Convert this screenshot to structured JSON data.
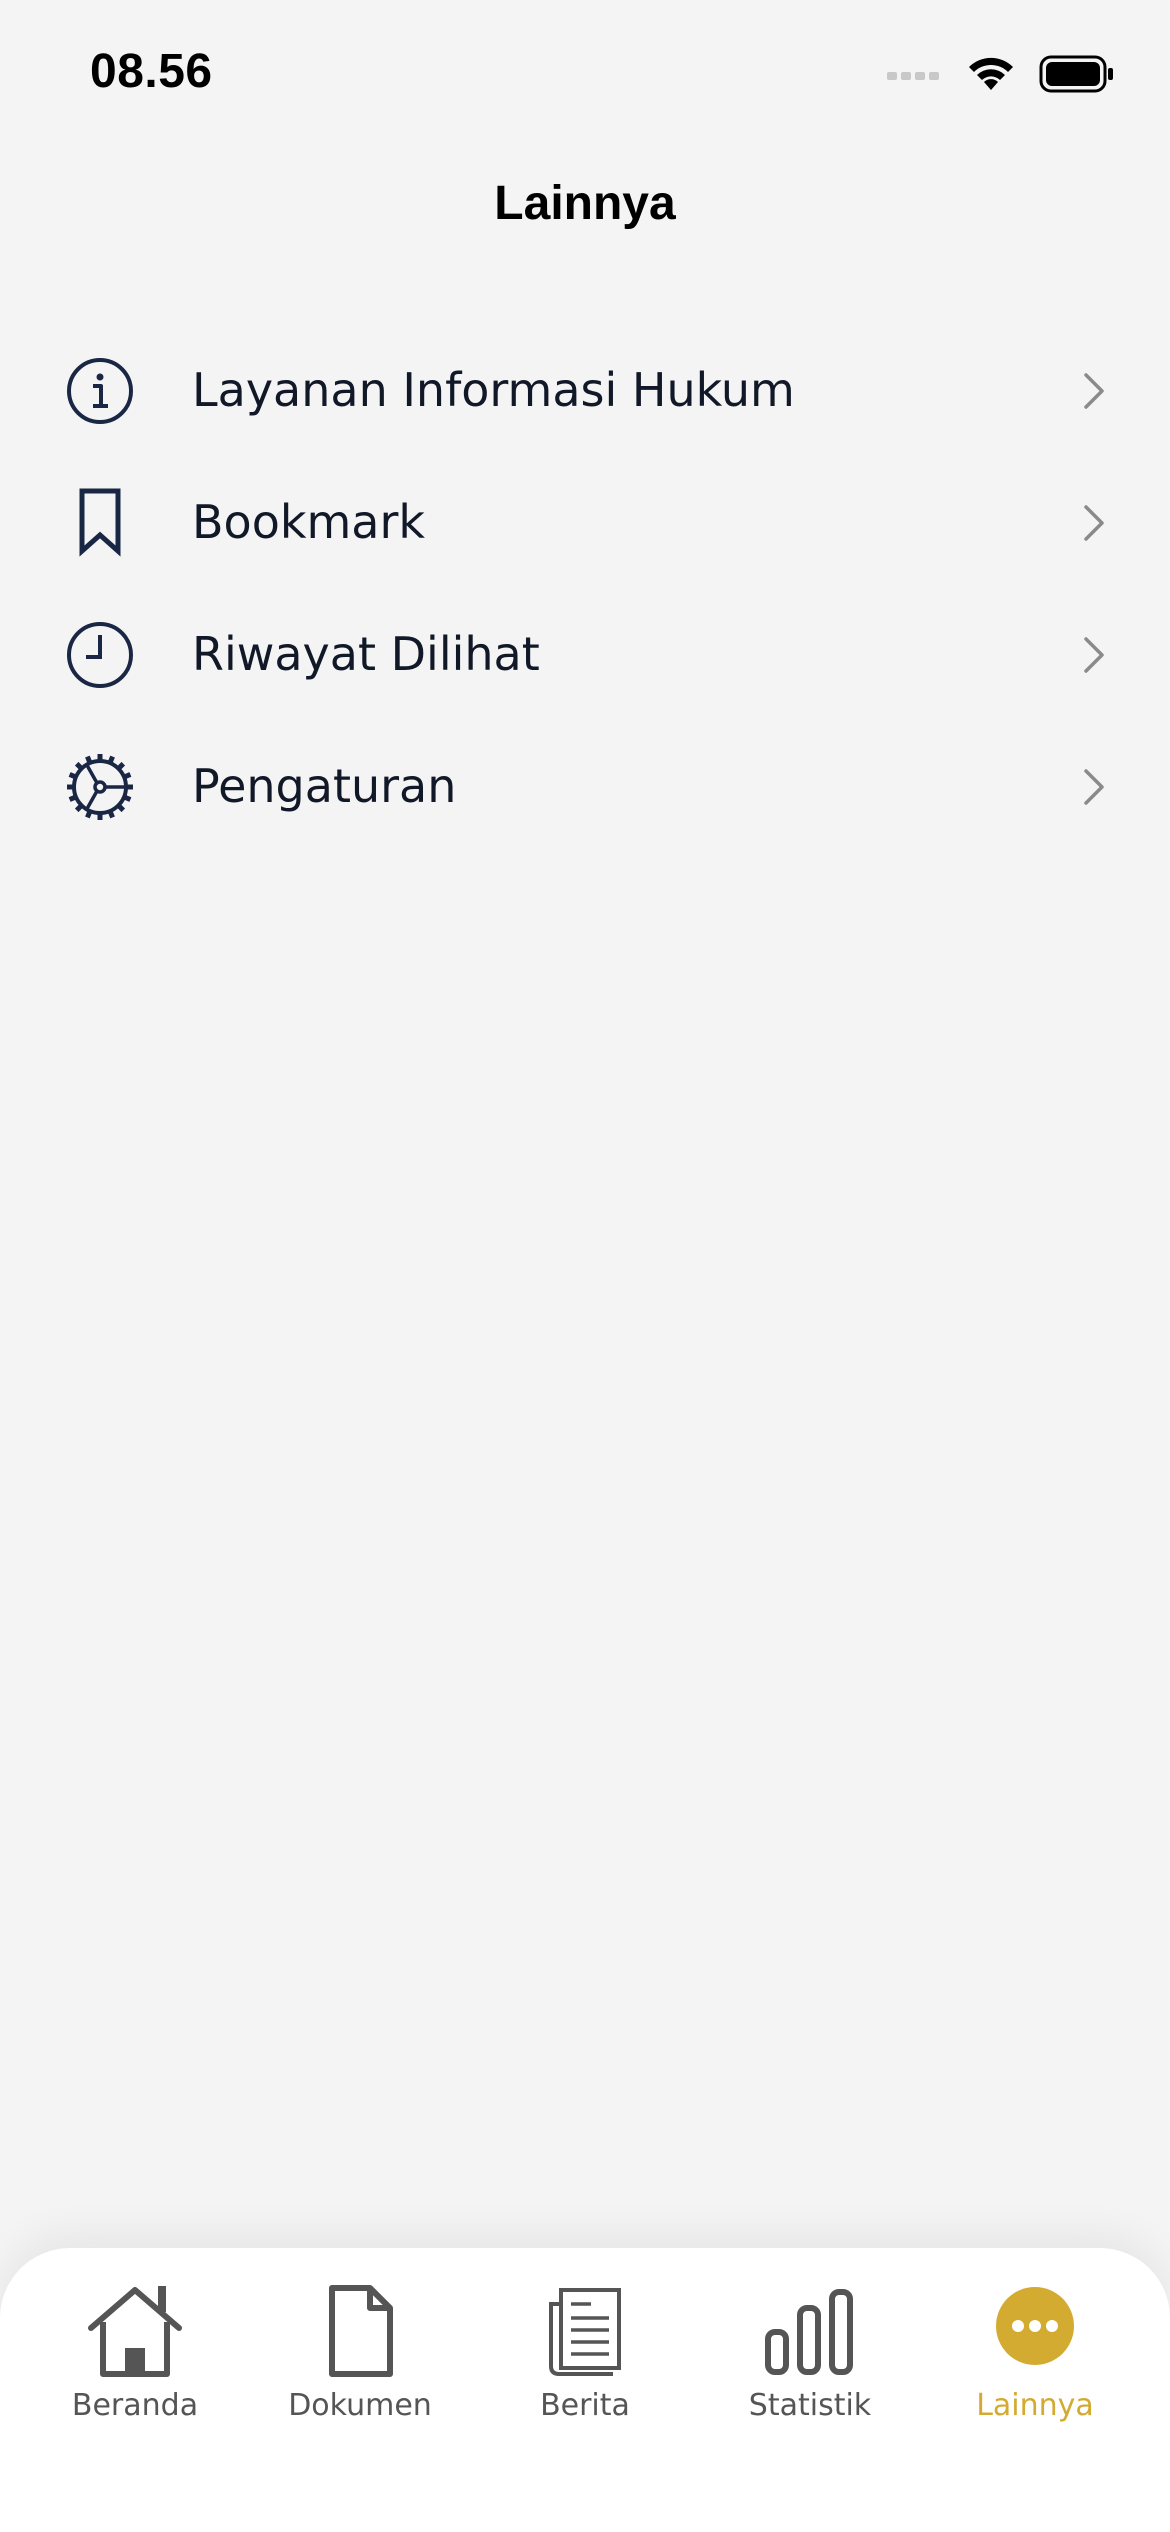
{
  "status_bar": {
    "time": "08.56"
  },
  "header": {
    "title": "Lainnya"
  },
  "menu": {
    "items": [
      {
        "label": "Layanan Informasi Hukum",
        "icon": "info-icon"
      },
      {
        "label": "Bookmark",
        "icon": "bookmark-icon"
      },
      {
        "label": "Riwayat Dilihat",
        "icon": "clock-icon"
      },
      {
        "label": "Pengaturan",
        "icon": "gear-icon"
      }
    ]
  },
  "bottom_nav": {
    "items": [
      {
        "label": "Beranda",
        "icon": "home-icon",
        "active": false
      },
      {
        "label": "Dokumen",
        "icon": "document-icon",
        "active": false
      },
      {
        "label": "Berita",
        "icon": "news-icon",
        "active": false
      },
      {
        "label": "Statistik",
        "icon": "bar-chart-icon",
        "active": false
      },
      {
        "label": "Lainnya",
        "icon": "more-icon",
        "active": true
      }
    ]
  },
  "colors": {
    "background": "#f4f4f4",
    "icon_navy": "#1a2744",
    "accent_gold": "#d4ab31",
    "nav_inactive": "#555555"
  }
}
